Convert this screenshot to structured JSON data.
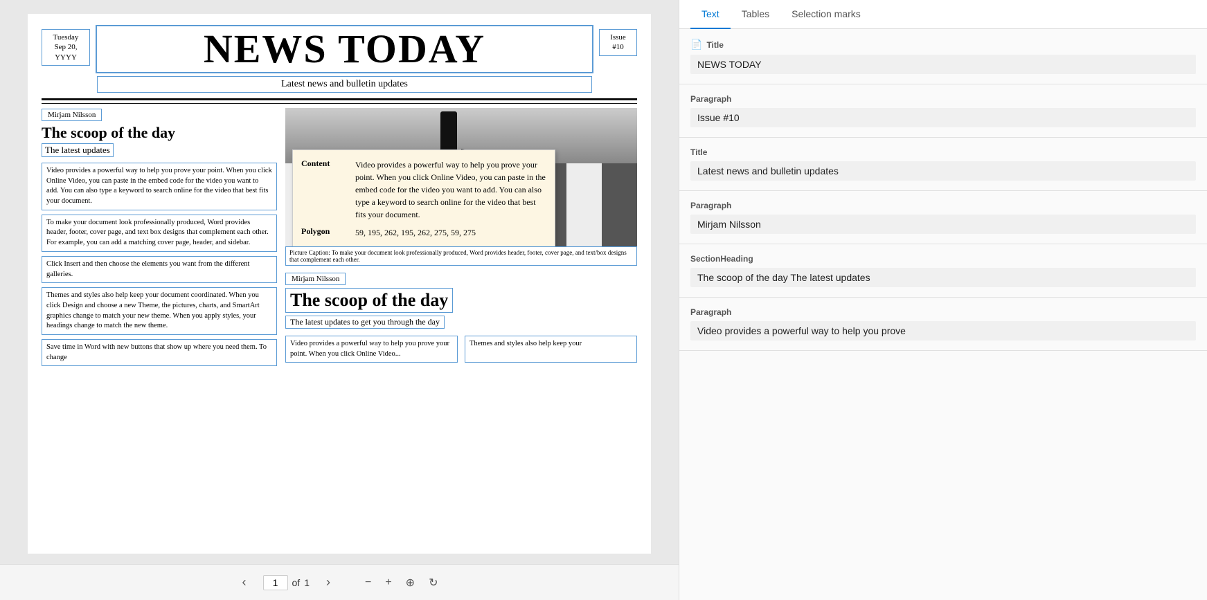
{
  "doc": {
    "title": "NEWS TODAY",
    "date": "Tuesday\nSep 20,\nYYYY",
    "issue": "Issue\n#10",
    "subtitle": "Latest news and bulletin updates",
    "divider": true
  },
  "article1": {
    "author": "Mirjam Nilsson",
    "heading": "The scoop of the day",
    "subheading": "The latest updates",
    "para1": "Video provides a powerful way to help you prove your point. When you click Online Video, you can paste in the embed code for the video you want to add. You can also type a keyword to search online for the video that best fits your document.",
    "para2": "To make your document look professionally produced, Word provides header, footer, cover page, and text box designs that complement each other. For example, you can add a matching cover page, header, and sidebar.",
    "para3": "Click Insert and then choose the elements you want from the different galleries.",
    "para4": "Themes and styles also help keep your document coordinated. When you click Design and choose a new Theme, the pictures, charts, and SmartArt graphics change to match your new theme. When you apply styles, your headings change to match the new theme.",
    "para5": "Save time in Word with new buttons that show up where you need them. To change"
  },
  "tooltip": {
    "content_label": "Content",
    "content_value": "Video provides a powerful way to help you prove your point. When you click Online Video, you can paste in the embed code for the video you want to add. You can also type a keyword to search online for the video that best fits your document.",
    "polygon_label": "Polygon",
    "polygon_value": "59, 195, 262, 195, 262, 275, 59, 275"
  },
  "caption": "Picture Caption: To make your document look professionally produced, Word provides header, footer, cover page, and text/box designs that complement each other.",
  "article2": {
    "author": "Mirjam Nilsson",
    "heading": "The scoop of the day",
    "subheading": "The latest updates to get you through the day",
    "para_left": "Video provides a powerful way to help you prove your point. When you click Online Video...",
    "para_right": "Themes and styles also help keep your"
  },
  "pagination": {
    "current": "1",
    "of_label": "of",
    "total": "1"
  },
  "right_panel": {
    "tabs": [
      {
        "id": "text",
        "label": "Text",
        "active": true
      },
      {
        "id": "tables",
        "label": "Tables",
        "active": false
      },
      {
        "id": "selection_marks",
        "label": "Selection marks",
        "active": false
      }
    ],
    "results": [
      {
        "type": "Title",
        "value": "NEWS TODAY"
      },
      {
        "type": "Paragraph",
        "value": "Issue #10"
      },
      {
        "type": "Title",
        "value": "Latest news and bulletin updates"
      },
      {
        "type": "Paragraph",
        "value": "Mirjam Nilsson"
      },
      {
        "type": "SectionHeading",
        "value": "The scoop of the day The latest updates"
      },
      {
        "type": "Paragraph",
        "value": "Video provides a powerful way to help you prove"
      }
    ]
  }
}
